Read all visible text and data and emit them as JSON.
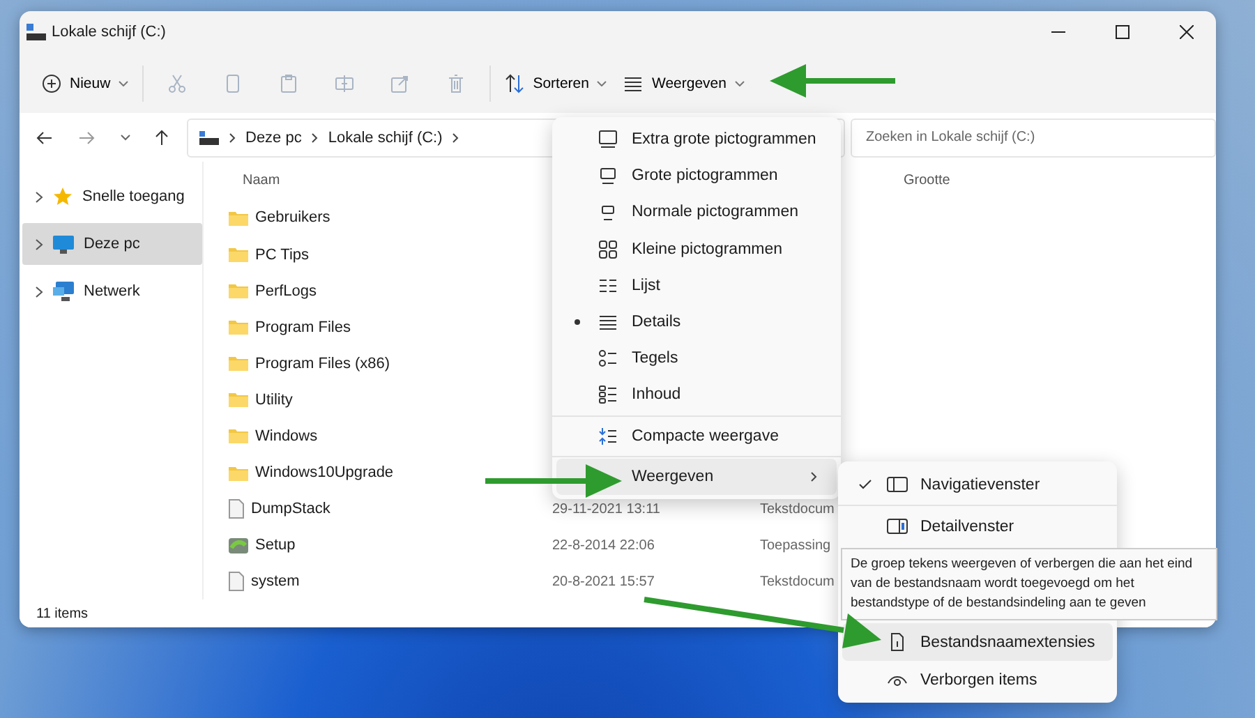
{
  "window": {
    "title": "Lokale schijf (C:)"
  },
  "toolbar": {
    "new_button": "Nieuw",
    "actions": [
      {
        "kind": "cut",
        "disabled": true
      },
      {
        "kind": "copy",
        "disabled": true
      },
      {
        "kind": "paste",
        "disabled": true
      },
      {
        "kind": "rename",
        "disabled": true
      },
      {
        "kind": "share",
        "disabled": true
      },
      {
        "kind": "delete",
        "disabled": true
      }
    ],
    "sort_button": "Sorteren",
    "view_button": "Weergeven"
  },
  "address": {
    "path": [
      "Deze pc",
      "Lokale schijf (C:)"
    ]
  },
  "search": {
    "placeholder": "Zoeken in Lokale schijf (C:)"
  },
  "sidebar": {
    "items": [
      {
        "label": "Snelle toegang",
        "kind": "star",
        "selected": false
      },
      {
        "label": "Deze pc",
        "kind": "computer",
        "selected": true
      },
      {
        "label": "Netwerk",
        "kind": "network",
        "selected": false
      }
    ]
  },
  "file_list": {
    "columns": {
      "name": "Naam",
      "size": "Grootte"
    },
    "rows": [
      {
        "name": "Gebruikers",
        "kind": "folder"
      },
      {
        "name": "PC Tips",
        "kind": "folder"
      },
      {
        "name": "PerfLogs",
        "kind": "folder"
      },
      {
        "name": "Program Files",
        "kind": "folder"
      },
      {
        "name": "Program Files (x86)",
        "kind": "folder"
      },
      {
        "name": "Utility",
        "kind": "folder"
      },
      {
        "name": "Windows",
        "kind": "folder"
      },
      {
        "name": "Windows10Upgrade",
        "kind": "folder"
      },
      {
        "name": "DumpStack",
        "kind": "document",
        "modified": "29-11-2021 13:11",
        "type": "Tekstdocum"
      },
      {
        "name": "Setup",
        "kind": "app",
        "modified": "22-8-2014 22:06",
        "type": "Toepassing"
      },
      {
        "name": "system",
        "kind": "document",
        "modified": "20-8-2021 15:57",
        "type": "Tekstdocum"
      }
    ]
  },
  "status_bar": {
    "count": "11 items"
  },
  "view_menu": {
    "items": [
      {
        "label": "Extra grote pictogrammen",
        "kind": "layout",
        "selected": false,
        "highlighted": false
      },
      {
        "label": "Grote pictogrammen",
        "kind": "layout",
        "selected": false,
        "highlighted": false
      },
      {
        "label": "Normale pictogrammen",
        "kind": "layout",
        "selected": false,
        "highlighted": false
      },
      {
        "label": "Kleine pictogrammen",
        "kind": "layout",
        "selected": false,
        "highlighted": false
      },
      {
        "label": "Lijst",
        "kind": "layout",
        "selected": false,
        "highlighted": false
      },
      {
        "label": "Details",
        "kind": "layout",
        "selected": true,
        "highlighted": false
      },
      {
        "label": "Tegels",
        "kind": "layout",
        "selected": false,
        "highlighted": false
      },
      {
        "label": "Inhoud",
        "kind": "layout",
        "selected": false,
        "highlighted": false
      },
      {
        "label": "Compacte weergave",
        "kind": "toggle",
        "selected": false,
        "highlighted": false
      },
      {
        "label": "Weergeven",
        "kind": "submenu",
        "selected": false,
        "highlighted": true
      }
    ]
  },
  "show_submenu": {
    "items": [
      {
        "label": "Navigatievenster",
        "checked": true,
        "highlighted": false
      },
      {
        "label": "Detailvenster",
        "checked": false,
        "highlighted": false
      },
      {
        "label": "Bestandsnaamextensies",
        "checked": false,
        "highlighted": true
      },
      {
        "label": "Verborgen items",
        "checked": false,
        "highlighted": false
      }
    ]
  },
  "tooltip": {
    "text": "De groep tekens weergeven of verbergen die aan het eind van de bestandsnaam wordt toegevoegd om het bestandstype of de bestandsindeling aan te geven"
  }
}
